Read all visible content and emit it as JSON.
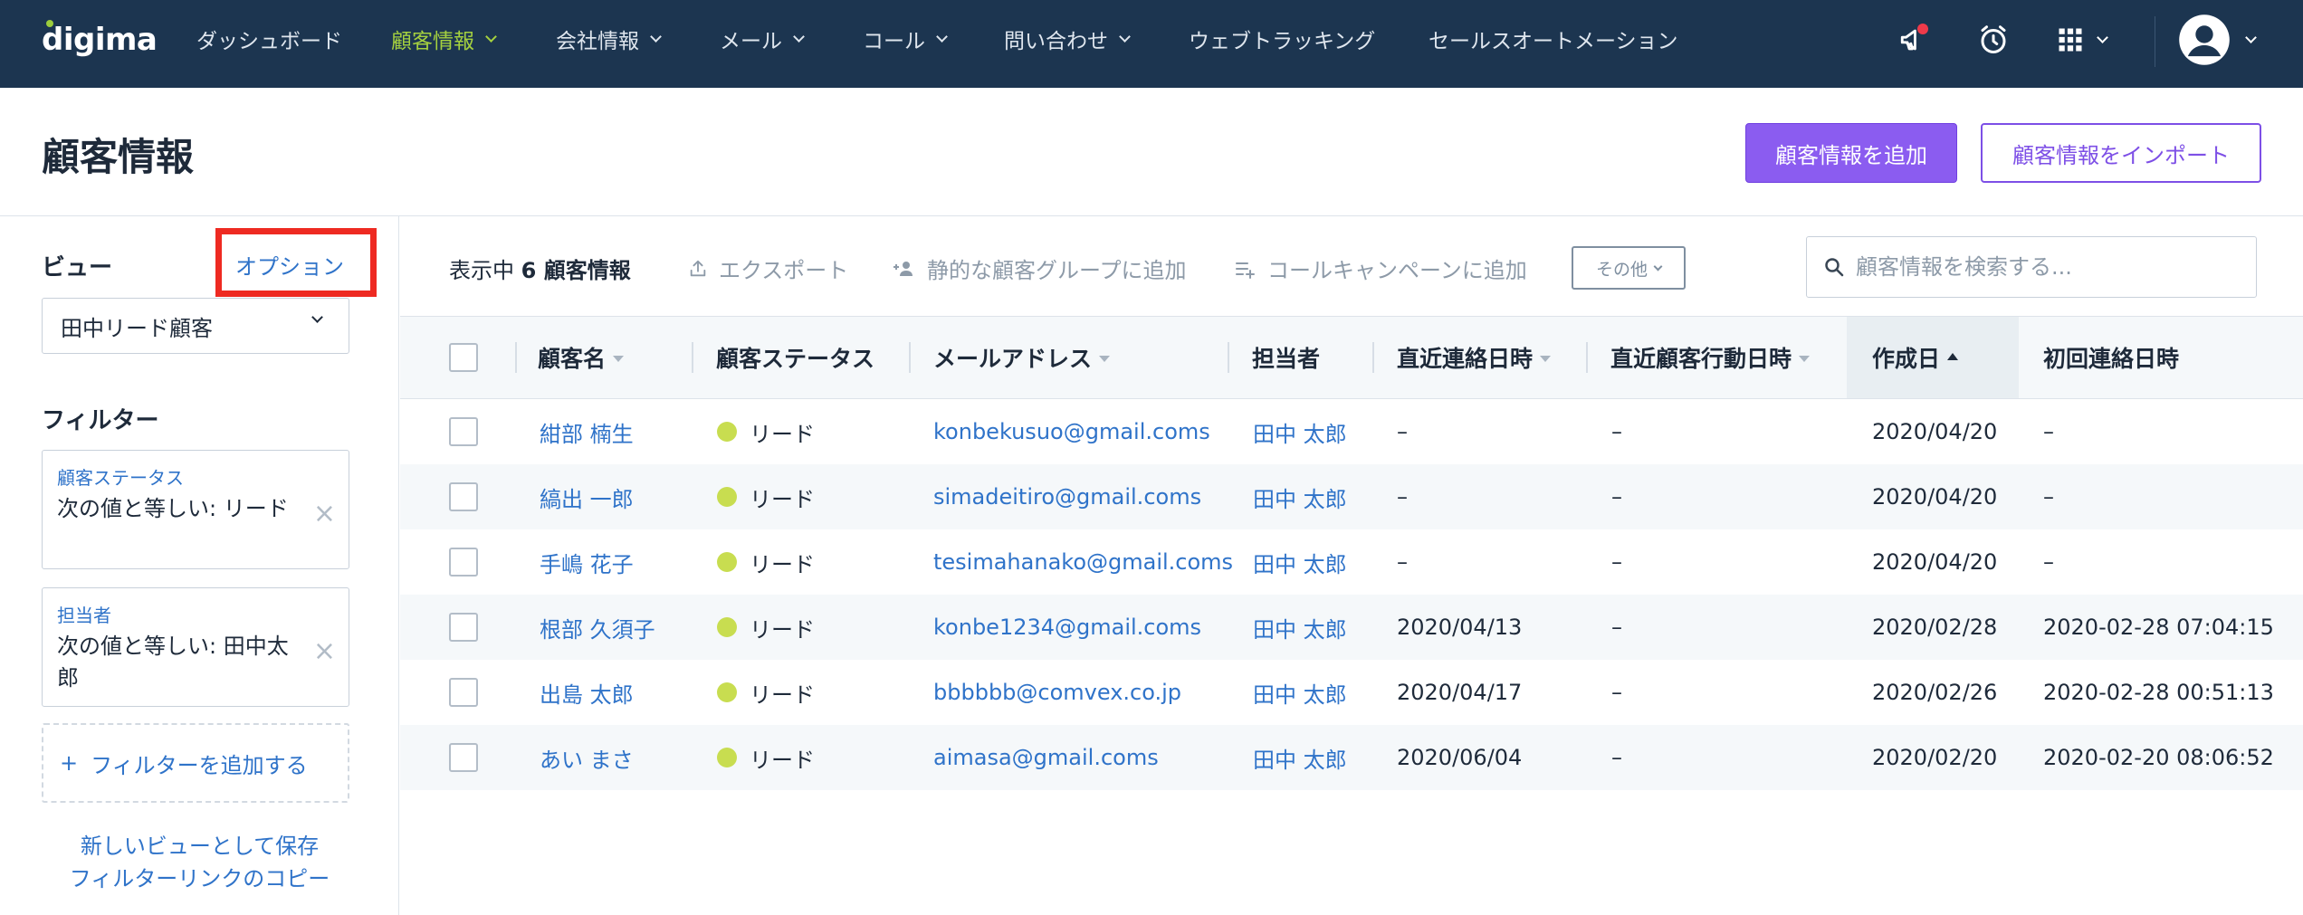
{
  "brand": {
    "name": "digima",
    "dot_color": "#9ccd3c"
  },
  "nav": {
    "items": [
      {
        "label": "ダッシュボード"
      },
      {
        "label": "顧客情報"
      },
      {
        "label": "会社情報"
      },
      {
        "label": "メール"
      },
      {
        "label": "コール"
      },
      {
        "label": "問い合わせ"
      },
      {
        "label": "ウェブトラッキング"
      },
      {
        "label": "セールスオートメーション"
      }
    ],
    "active_color": "#a5d13f",
    "bg_color": "#1c3550",
    "icons": [
      "megaphone-icon",
      "alarm-clock-icon",
      "apps-grid-icon",
      "user-avatar-icon"
    ]
  },
  "header": {
    "title": "顧客情報",
    "add_button": "顧客情報を追加",
    "import_button": "顧客情報をインポート",
    "accent_color": "#8b5cf0"
  },
  "sidebar": {
    "view_label": "ビュー",
    "option_link": "オプション",
    "selected_view": "田中リード顧客",
    "filter_label": "フィルター",
    "filters": [
      {
        "title": "顧客ステータス",
        "value": "次の値と等しい: リード"
      },
      {
        "title": "担当者",
        "value": "次の値と等しい: 田中太郎"
      }
    ],
    "add_filter": "フィルターを追加する",
    "save_view": "新しいビューとして保存",
    "copy_link": "フィルターリンクのコピー"
  },
  "toolbar": {
    "showing_prefix": "表示中",
    "showing_count": "6 顧客情報",
    "export": "エクスポート",
    "add_static_group": "静的な顧客グループに追加",
    "add_call_campaign": "コールキャンペーンに追加",
    "more": "その他",
    "search_placeholder": "顧客情報を検索する..."
  },
  "table": {
    "columns": [
      "顧客名",
      "顧客ステータス",
      "メールアドレス",
      "担当者",
      "直近連絡日時",
      "直近顧客行動日時",
      "作成日",
      "初回連絡日時"
    ],
    "rows": [
      {
        "name": "紺部 楠生",
        "status": "リード",
        "email": "konbekusuo@gmail.coms",
        "owner": "田中 太郎",
        "last_contact": "–",
        "last_activity": "–",
        "created": "2020/04/20",
        "first_contact": "–"
      },
      {
        "name": "縞出 一郎",
        "status": "リード",
        "email": "simadeitiro@gmail.coms",
        "owner": "田中 太郎",
        "last_contact": "–",
        "last_activity": "–",
        "created": "2020/04/20",
        "first_contact": "–"
      },
      {
        "name": "手嶋 花子",
        "status": "リード",
        "email": "tesimahanako@gmail.coms",
        "owner": "田中 太郎",
        "last_contact": "–",
        "last_activity": "–",
        "created": "2020/04/20",
        "first_contact": "–"
      },
      {
        "name": "根部 久須子",
        "status": "リード",
        "email": "konbe1234@gmail.coms",
        "owner": "田中 太郎",
        "last_contact": "2020/04/13",
        "last_activity": "–",
        "created": "2020/02/28",
        "first_contact": "2020-02-28 07:04:15"
      },
      {
        "name": "出島 太郎",
        "status": "リード",
        "email": "bbbbbb@comvex.co.jp",
        "owner": "田中 太郎",
        "last_contact": "2020/04/17",
        "last_activity": "–",
        "created": "2020/02/26",
        "first_contact": "2020-02-28 00:51:13"
      },
      {
        "name": "あい まさ",
        "status": "リード",
        "email": "aimasa@gmail.coms",
        "owner": "田中 太郎",
        "last_contact": "2020/06/04",
        "last_activity": "–",
        "created": "2020/02/20",
        "first_contact": "2020-02-20 08:06:52"
      }
    ],
    "status_color": "#c8dd50",
    "link_color": "#2f73c9"
  }
}
